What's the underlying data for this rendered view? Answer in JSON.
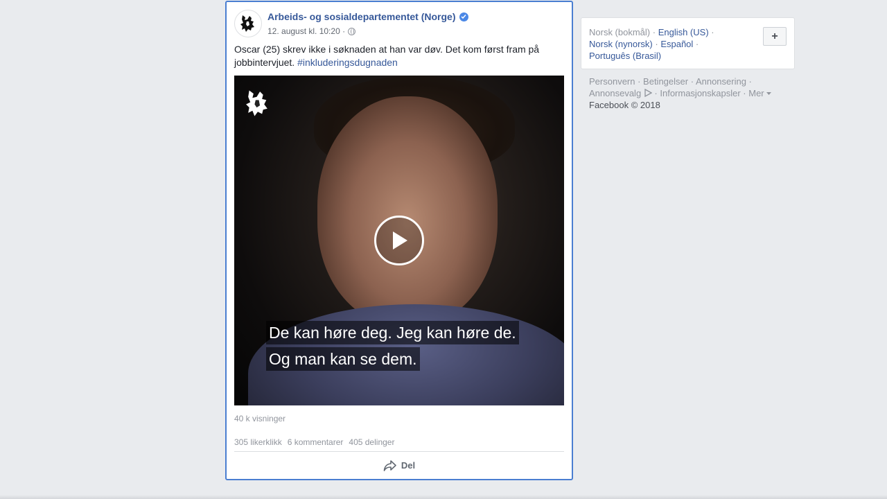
{
  "post": {
    "page_name": "Arbeids- og sosialdepartementet (Norge)",
    "timestamp": "12. august kl. 10:20 ·",
    "text": "Oscar (25) skrev ikke i søknaden at han var døv. Det kom først fram på jobbintervjuet. ",
    "hashtag": "#inkluderingsdugnaden",
    "video": {
      "subtitle_line_1": "De kan høre deg. Jeg kan høre de.",
      "subtitle_line_2": "Og man kan se dem."
    },
    "views": "40 k visninger",
    "likes": "305 likerklikk",
    "comments": "6 kommentarer",
    "shares": "405 delinger",
    "share_label": "Del"
  },
  "sidebar": {
    "languages": {
      "current": "Norsk (bokmål)",
      "english": "English (US)",
      "nynorsk": "Norsk (nynorsk)",
      "spanish": "Español",
      "portuguese": "Português (Brasil)",
      "add_label": "+"
    },
    "footer": {
      "privacy": "Personvern",
      "terms": "Betingelser",
      "advertising": "Annonsering",
      "ad_choices": "Annonsevalg",
      "cookies": "Informasjonskapsler",
      "more": "Mer",
      "copyright": "Facebook © 2018"
    }
  },
  "colors": {
    "link": "#365899",
    "verified": "#4b88e6",
    "focus_border": "#4a7ed1"
  }
}
